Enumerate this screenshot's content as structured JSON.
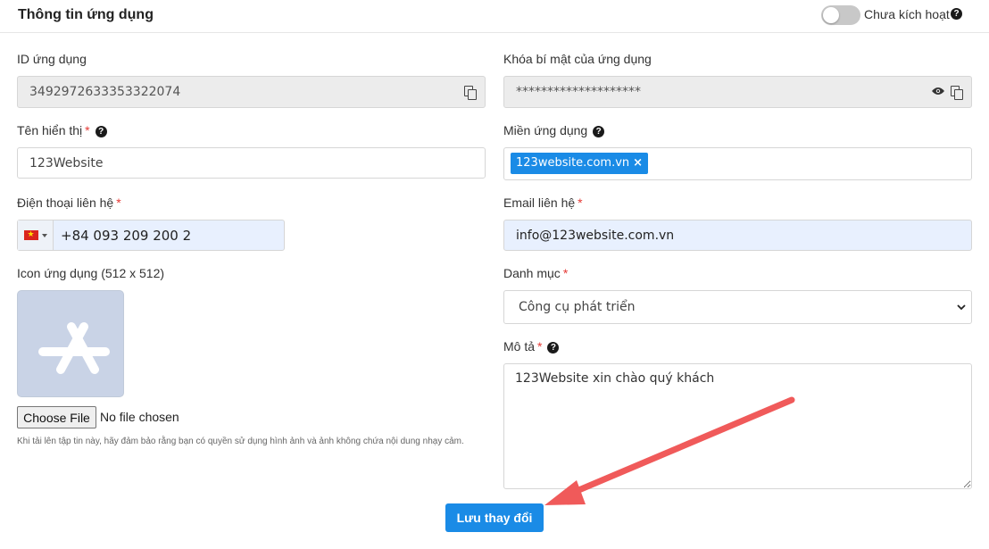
{
  "header": {
    "title": "Thông tin ứng dụng",
    "toggle_label": "Chưa kích hoạt",
    "toggle_on": false
  },
  "fields": {
    "app_id": {
      "label": "ID ứng dụng",
      "value": "3492972633353322074"
    },
    "secret": {
      "label": "Khóa bí mật của ứng dụng",
      "value": "********************"
    },
    "display_name": {
      "label": "Tên hiển thị",
      "required_mark": "*",
      "value": "123Website"
    },
    "domain": {
      "label": "Miền ứng dụng",
      "tags": [
        "123website.com.vn"
      ],
      "tag_remove": "×"
    },
    "phone": {
      "label": "Điện thoại liên hệ",
      "required_mark": "*",
      "value": "+84 093 209 200 2",
      "flag_symbol": "★"
    },
    "email": {
      "label": "Email liên hệ",
      "required_mark": "*",
      "value": "info@123website.com.vn"
    },
    "icon": {
      "label": "Icon ứng dụng (512 x 512)",
      "file_button": "Choose File",
      "file_status": "No file chosen",
      "hint": "Khi tải lên tập tin này, hãy đảm bảo rằng bạn có quyền sử dụng hình ảnh và ảnh không chứa nội dung nhạy cảm."
    },
    "category": {
      "label": "Danh mục",
      "required_mark": "*",
      "selected": "Công cụ phát triển"
    },
    "description": {
      "label": "Mô tả",
      "required_mark": "*",
      "value": "123Website xin chào quý khách"
    }
  },
  "help_glyph": "?",
  "save_label": "Lưu thay đổi",
  "colors": {
    "primary": "#1a8be6",
    "annotation_arrow": "#f05a5a",
    "required": "#e53935"
  }
}
